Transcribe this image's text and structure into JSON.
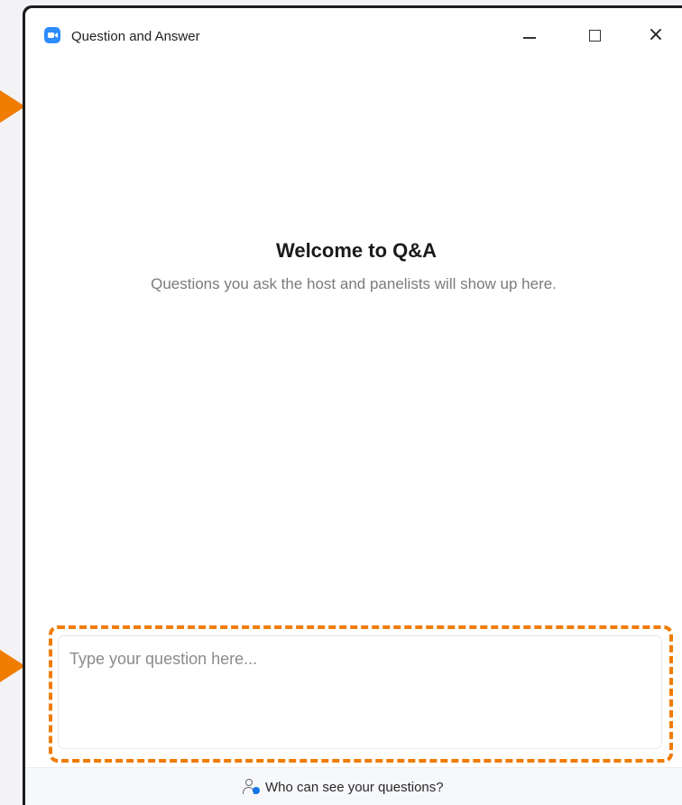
{
  "window": {
    "title": "Question and Answer",
    "logo_icon": "app-video-camera-icon",
    "controls": {
      "minimize_icon": "minimize-icon",
      "maximize_icon": "maximize-icon",
      "close_icon": "close-icon",
      "close_glyph": "×"
    }
  },
  "welcome": {
    "title": "Welcome to Q&A",
    "subtitle": "Questions you ask the host and panelists will show up here."
  },
  "question_input": {
    "value": "",
    "placeholder": "Type your question here..."
  },
  "footer": {
    "visibility_link_label": "Who can see your questions?",
    "visibility_icon": "user-visibility-icon"
  },
  "annotation_colors": {
    "highlight": "#f07c00",
    "accent_blue": "#2d8cff"
  }
}
